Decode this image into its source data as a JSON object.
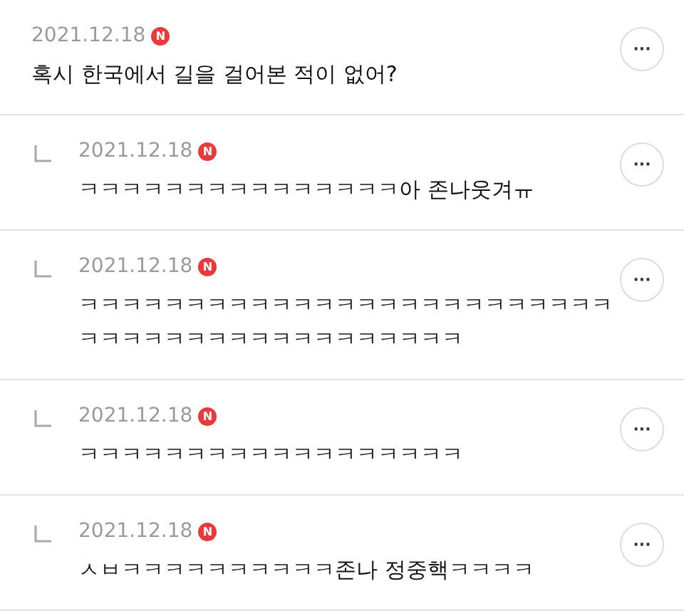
{
  "comments": [
    {
      "kind": "comment",
      "date": "2021.12.18",
      "is_new": true,
      "new_badge": "N",
      "text": "혹시 한국에서 길을 걸어본 적이 없어?",
      "more": "···"
    },
    {
      "kind": "reply",
      "date": "2021.12.18",
      "is_new": true,
      "new_badge": "N",
      "text": "ㅋㅋㅋㅋㅋㅋㅋㅋㅋㅋㅋㅋㅋㅋㅋ아 존나웃겨ㅠ",
      "more": "···"
    },
    {
      "kind": "reply",
      "date": "2021.12.18",
      "is_new": true,
      "new_badge": "N",
      "text": "ㅋㅋㅋㅋㅋㅋㅋㅋㅋㅋㅋㅋㅋㅋㅋㅋㅋㅋㅋㅋㅋㅋㅋㅋㅋㅋㅋㅋㅋㅋㅋㅋㅋㅋㅋㅋㅋㅋㅋㅋㅋㅋㅋ",
      "more": "···"
    },
    {
      "kind": "reply",
      "date": "2021.12.18",
      "is_new": true,
      "new_badge": "N",
      "text": "ㅋㅋㅋㅋㅋㅋㅋㅋㅋㅋㅋㅋㅋㅋㅋㅋㅋㅋ",
      "more": "···"
    },
    {
      "kind": "reply",
      "date": "2021.12.18",
      "is_new": true,
      "new_badge": "N",
      "text": "ㅅㅂㅋㅋㅋㅋㅋㅋㅋㅋㅋㅋ존나 정중핵ㅋㅋㅋㅋ",
      "more": "···"
    }
  ]
}
